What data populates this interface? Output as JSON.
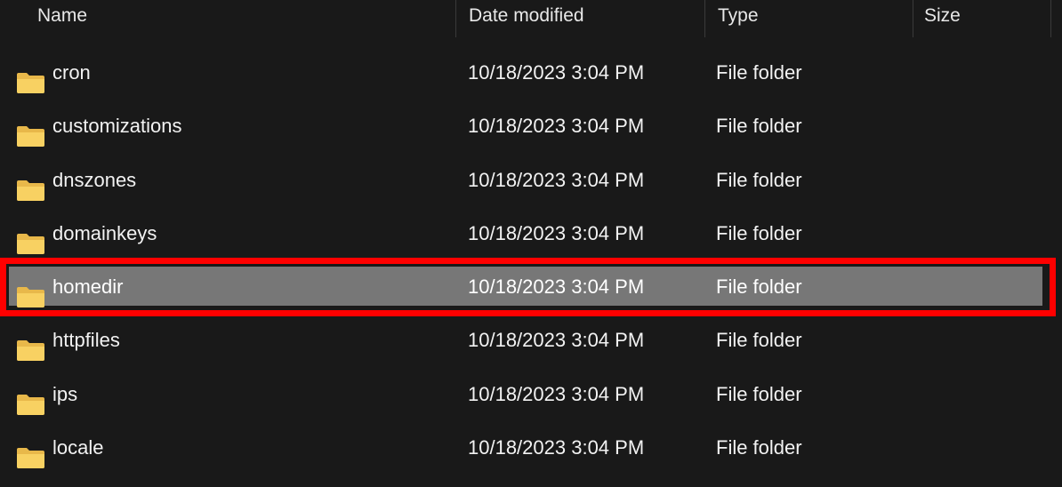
{
  "columns": {
    "name": "Name",
    "date_modified": "Date modified",
    "type": "Type",
    "size": "Size"
  },
  "files": [
    {
      "name": "cron",
      "date": "10/18/2023 3:04 PM",
      "type": "File folder",
      "size": ""
    },
    {
      "name": "customizations",
      "date": "10/18/2023 3:04 PM",
      "type": "File folder",
      "size": ""
    },
    {
      "name": "dnszones",
      "date": "10/18/2023 3:04 PM",
      "type": "File folder",
      "size": ""
    },
    {
      "name": "domainkeys",
      "date": "10/18/2023 3:04 PM",
      "type": "File folder",
      "size": ""
    },
    {
      "name": "homedir",
      "date": "10/18/2023 3:04 PM",
      "type": "File folder",
      "size": "",
      "selected": true
    },
    {
      "name": "httpfiles",
      "date": "10/18/2023 3:04 PM",
      "type": "File folder",
      "size": ""
    },
    {
      "name": "ips",
      "date": "10/18/2023 3:04 PM",
      "type": "File folder",
      "size": ""
    },
    {
      "name": "locale",
      "date": "10/18/2023 3:04 PM",
      "type": "File folder",
      "size": ""
    }
  ],
  "icons": {
    "folder": "folder-icon"
  },
  "colors": {
    "background": "#191919",
    "selection": "#777777",
    "highlight_frame": "#ff0000",
    "folder_yellow": "#f8d162"
  }
}
